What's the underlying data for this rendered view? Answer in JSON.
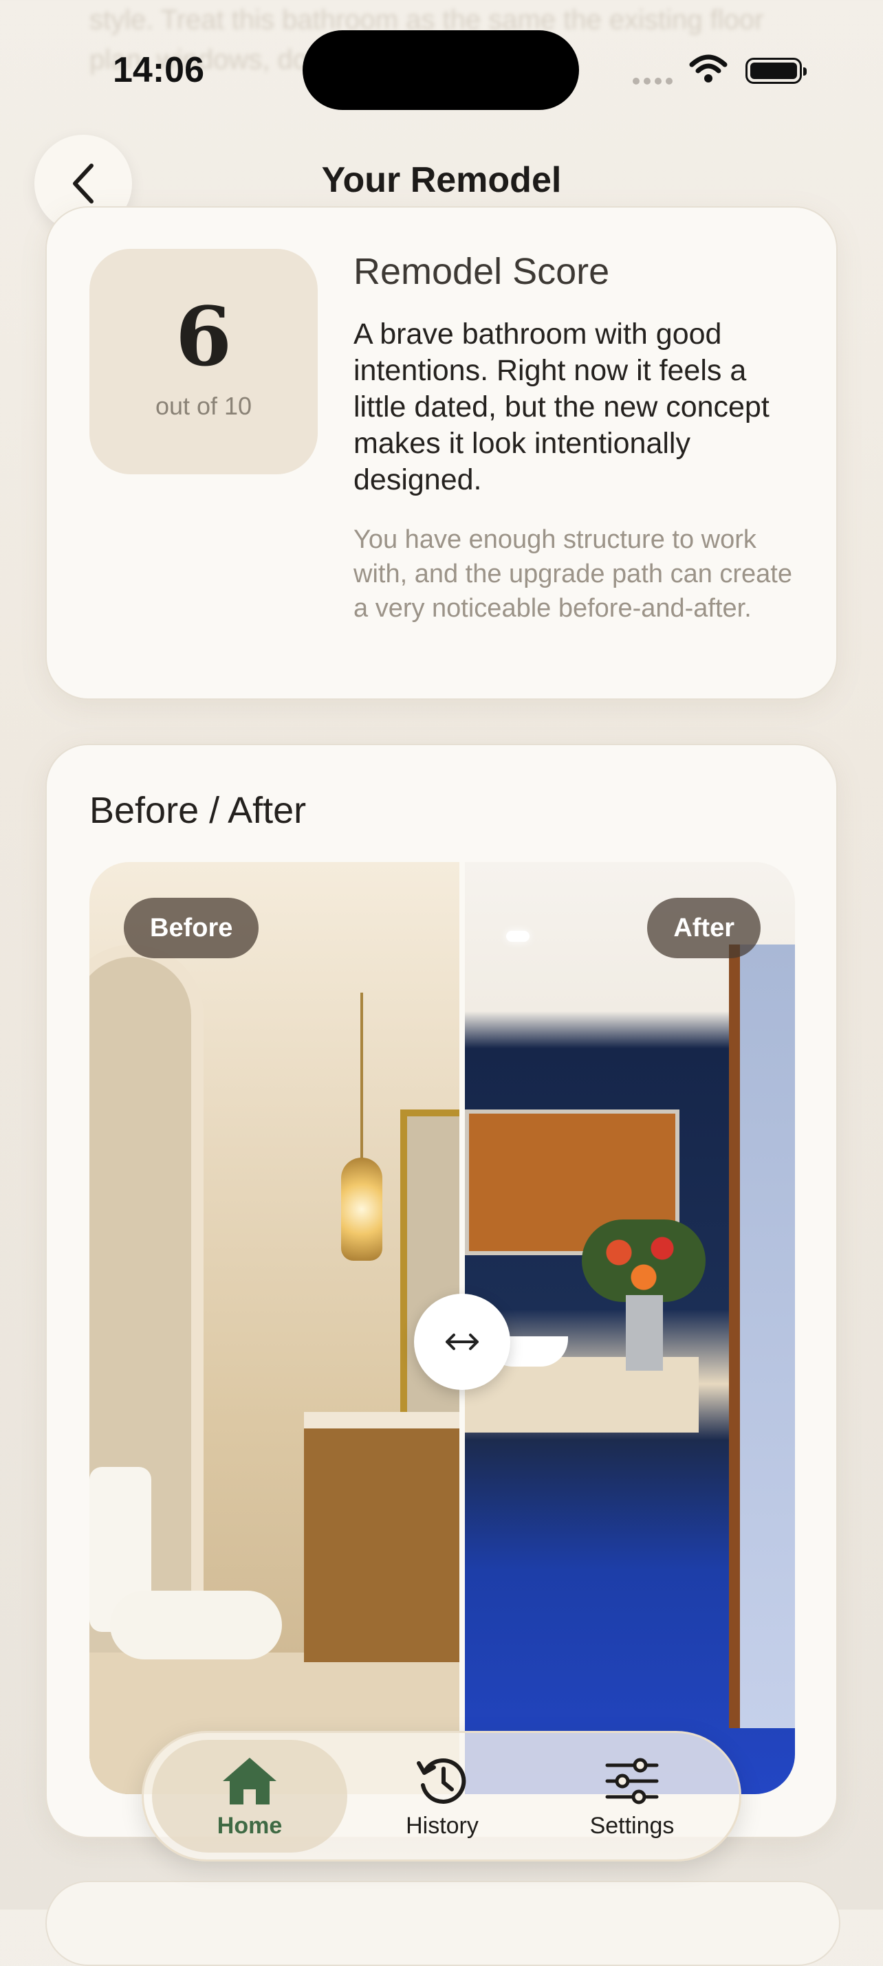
{
  "status_bar": {
    "time": "14:06"
  },
  "background_text": "style. Treat this bathroom as the same the existing floor plan, windows, doors, and",
  "header": {
    "title": "Your Remodel"
  },
  "score_card": {
    "title": "Remodel Score",
    "score": "6",
    "score_suffix": "out of 10",
    "summary": "A brave bathroom with good intentions. Right now it feels a little dated, but the new concept makes it look intentionally designed.",
    "note": "You have enough structure to work with, and the upgrade path can create a very noticeable before-and-after."
  },
  "before_after": {
    "title": "Before / After",
    "before_label": "Before",
    "after_label": "After",
    "slider_position": 0.5
  },
  "tabbar": {
    "items": [
      {
        "label": "Home",
        "icon": "home-icon",
        "active": true
      },
      {
        "label": "History",
        "icon": "history-icon",
        "active": false
      },
      {
        "label": "Settings",
        "icon": "sliders-icon",
        "active": false
      }
    ],
    "accent_color": "#3f6a44"
  }
}
